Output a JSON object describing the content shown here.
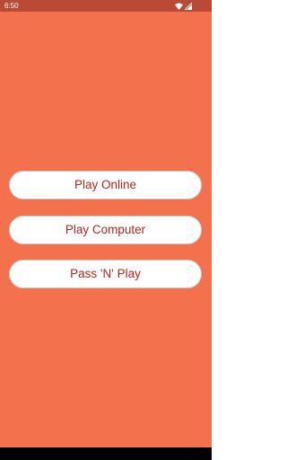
{
  "status_bar": {
    "time": "6:50",
    "icons": [
      "wifi-icon",
      "signal-icon"
    ],
    "color": "#B84A36"
  },
  "theme": {
    "background": "#F4714D",
    "button_background": "#FFFFFF",
    "button_text": "#B3261E"
  },
  "menu": {
    "buttons": [
      {
        "label": "Play Online"
      },
      {
        "label": "Play Computer"
      },
      {
        "label": "Pass 'N' Play"
      }
    ]
  }
}
